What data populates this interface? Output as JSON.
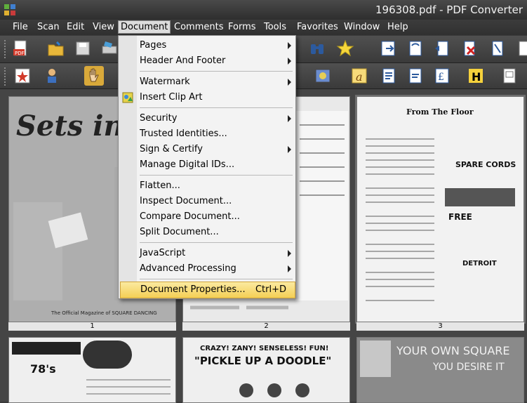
{
  "window": {
    "title": "196308.pdf - PDF Converter"
  },
  "menubar": {
    "items": [
      "File",
      "Scan",
      "Edit",
      "View",
      "Document",
      "Comments",
      "Forms",
      "Tools",
      "Favorites",
      "Window",
      "Help"
    ],
    "active": "Document"
  },
  "document_menu": {
    "pages": "Pages",
    "header_footer": "Header And Footer",
    "watermark": "Watermark",
    "insert_clip_art": "Insert Clip Art",
    "security": "Security",
    "trusted_identities": "Trusted Identities...",
    "sign_certify": "Sign & Certify",
    "manage_digital_ids": "Manage Digital IDs...",
    "flatten": "Flatten...",
    "inspect_document": "Inspect Document...",
    "compare_document": "Compare Document...",
    "split_document": "Split Document...",
    "javascript": "JavaScript",
    "advanced_processing": "Advanced Processing",
    "document_properties": "Document Properties...",
    "document_properties_shortcut": "Ctrl+D"
  },
  "thumbnails": {
    "page_labels": [
      "1",
      "2",
      "3"
    ],
    "page1_text": "Sets in Order",
    "page1_caption": "The Official Magazine of SQUARE DANCING",
    "page3_heading": "From The Floor",
    "page3_ad1": "SPARE CORDS",
    "page3_ad2": "FREE",
    "page3_ad3": "DETROIT",
    "page4_text": "78's",
    "page5_text": "\"PICKLE UP A DOODLE\"",
    "page5_top": "CRAZY!   ZANY!   SENSELESS!   FUN!",
    "page6_text": "YOUR OWN SQUARE",
    "page6_sub": "YOU DESIRE IT"
  },
  "icons": [
    "app-icon",
    "pdf-create-icon",
    "open-folder-icon",
    "save-icon",
    "print-icon",
    "binoculars-icon",
    "star-icon",
    "export-icon",
    "hand-tool-icon",
    "text-icon",
    "highlight-icon"
  ],
  "colors": {
    "menu_highlight": "#f4cf55",
    "chrome_dark": "#3a3a3a"
  }
}
